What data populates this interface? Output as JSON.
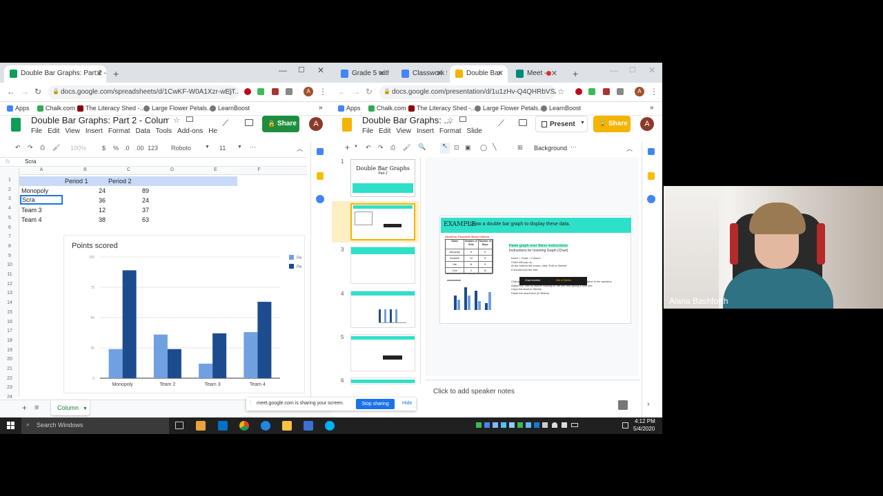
{
  "left_window": {
    "tab_title": "Double Bar Graphs: Part 2 - Colu",
    "url": "docs.google.com/spreadsheets/d/1CwKF-W0A1Xzr-wEjT...",
    "bookmarks": [
      "Apps",
      "Chalk.com",
      "The Literacy Shed -...",
      "Large Flower Petals...",
      "LearnBoost"
    ],
    "doc_title": "Double Bar Graphs: Part 2 - Column ...",
    "menu": [
      "File",
      "Edit",
      "View",
      "Insert",
      "Format",
      "Data",
      "Tools",
      "Add-ons",
      "He"
    ],
    "share_label": "Share",
    "avatar": "A",
    "toolbar": {
      "zoom": "100%",
      "currency": "$",
      "percent": "%",
      "dec1": ".0",
      "dec2": ".00",
      "format": "123",
      "font": "Roboto",
      "size": "11"
    },
    "formula_value": "Scra",
    "formula_fx": "fx",
    "columns": [
      "A",
      "B",
      "C",
      "D",
      "E",
      "F"
    ],
    "row_numbers": [
      "1",
      "2",
      "3",
      "4",
      "5",
      "6",
      "7",
      "8",
      "9",
      "10",
      "11",
      "12",
      "13",
      "14",
      "15",
      "16",
      "17",
      "18",
      "19",
      "20",
      "21",
      "22",
      "23",
      "24"
    ],
    "headers": [
      "",
      "Period 1",
      "Period 2"
    ],
    "rows": [
      [
        "Monopoly",
        "24",
        "89"
      ],
      [
        "Scra",
        "36",
        "24"
      ],
      [
        "Team 3",
        "12",
        "37"
      ],
      [
        "Team 4",
        "38",
        "63"
      ]
    ],
    "sheet_tab": "Column"
  },
  "chart_data": {
    "type": "bar",
    "title": "Points scored",
    "categories": [
      "Monopoly",
      "Team 2",
      "Team 3",
      "Team 4"
    ],
    "series": [
      {
        "name": "Pe",
        "values": [
          24,
          36,
          12,
          38
        ],
        "color": "#6fa0e0"
      },
      {
        "name": "Pe",
        "values": [
          89,
          24,
          37,
          63
        ],
        "color": "#1c4c8e"
      }
    ],
    "y_ticks": [
      "0",
      "25",
      "50",
      "75",
      "100"
    ],
    "ylim": [
      0,
      100
    ]
  },
  "right_window": {
    "tabs": [
      "Grade 5 with",
      "Classwork fo",
      "Double Bar",
      "Meet -"
    ],
    "url": "docs.google.com/presentation/d/1u1zHv-Q4QHRbVSZ2x...",
    "bookmarks": [
      "Apps",
      "Chalk.com",
      "The Literacy Shed -...",
      "Large Flower Petals...",
      "LearnBoost"
    ],
    "doc_title": "Double Bar Graphs: ...",
    "menu": [
      "File",
      "Edit",
      "View",
      "Insert",
      "Format",
      "Slide"
    ],
    "present_label": "Present",
    "share_label": "Share",
    "avatar": "A",
    "background_label": "Background",
    "slide_numbers": [
      "1",
      "2",
      "3",
      "4",
      "5",
      "6"
    ],
    "thumb1_title": "Double Bar Graphs",
    "thumb1_sub": "Part 2",
    "slide": {
      "heading_prefix": "EXAMPLE",
      "heading": "- Draw a double bar graph to display these data.",
      "table_title": "Students' Favourite Board Games",
      "table_headers": [
        "Game",
        "Number of Girls",
        "Number of Boys"
      ],
      "table_rows": [
        [
          "Monopoly",
          "8",
          "6"
        ],
        [
          "Scrabble",
          "13",
          "8"
        ],
        [
          "Life",
          "11",
          "5"
        ],
        [
          "Clue",
          "4",
          "10"
        ]
      ],
      "instr_title": "Paste graph over these instructions",
      "instr_sub": "Instructions for Inserting Graph (Chart)",
      "steps": [
        "Insert > Chart > Column",
        "Chart will pop up",
        "At the bottom left corner, click \"Edit in Sheets\"",
        "It should look like this:",
        "Change the information in sheets so that it matches the information in the question",
        "Adjust the Title by double clicking on the title and typing a new one.",
        "Copy the chart in Sheets",
        "Paste the chart here (in Slides)"
      ],
      "btn_insert": "Chart inserted",
      "btn_edit": "Edit in Sheets"
    },
    "speaker_notes": "Click to add speaker notes"
  },
  "sharing_bar": {
    "text": "meet.google.com is sharing your screen.",
    "stop": "Stop sharing",
    "hide": "Hide"
  },
  "video": {
    "name": "Alana Bashforth"
  },
  "taskbar": {
    "search": "Search Windows",
    "time": "4:12 PM",
    "date": "5/4/2020"
  }
}
